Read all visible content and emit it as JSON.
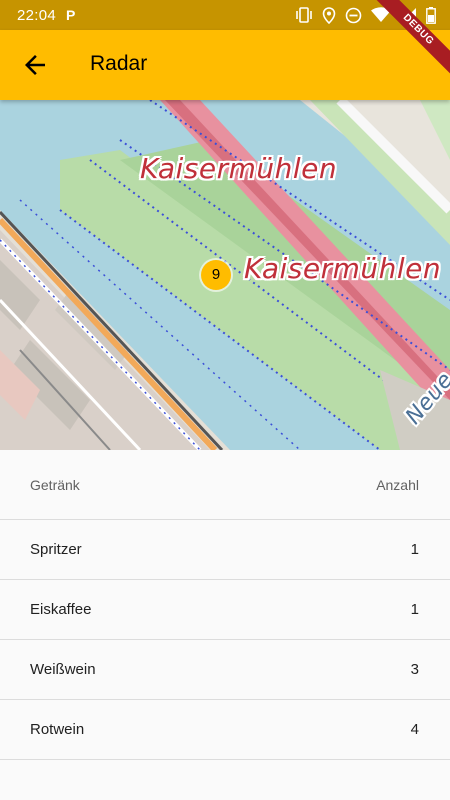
{
  "status_bar": {
    "time": "22:04",
    "notification_icon": "parking-icon",
    "icons": [
      "vibrate-icon",
      "location-icon",
      "do-not-disturb-icon",
      "wifi-icon",
      "signal-icon",
      "battery-icon"
    ]
  },
  "debug_banner": "DEBUG",
  "app_bar": {
    "title": "Radar",
    "back_icon": "arrow-back-icon",
    "color": "#ffbc00"
  },
  "map": {
    "labels": [
      "Kaisermühlen",
      "Kaisermühlen",
      "Neue"
    ],
    "marker_count": "9"
  },
  "table": {
    "headers": [
      "Getränk",
      "Anzahl"
    ],
    "rows": [
      {
        "drink": "Spritzer",
        "count": "1"
      },
      {
        "drink": "Eiskaffee",
        "count": "1"
      },
      {
        "drink": "Weißwein",
        "count": "3"
      },
      {
        "drink": "Rotwein",
        "count": "4"
      }
    ]
  }
}
